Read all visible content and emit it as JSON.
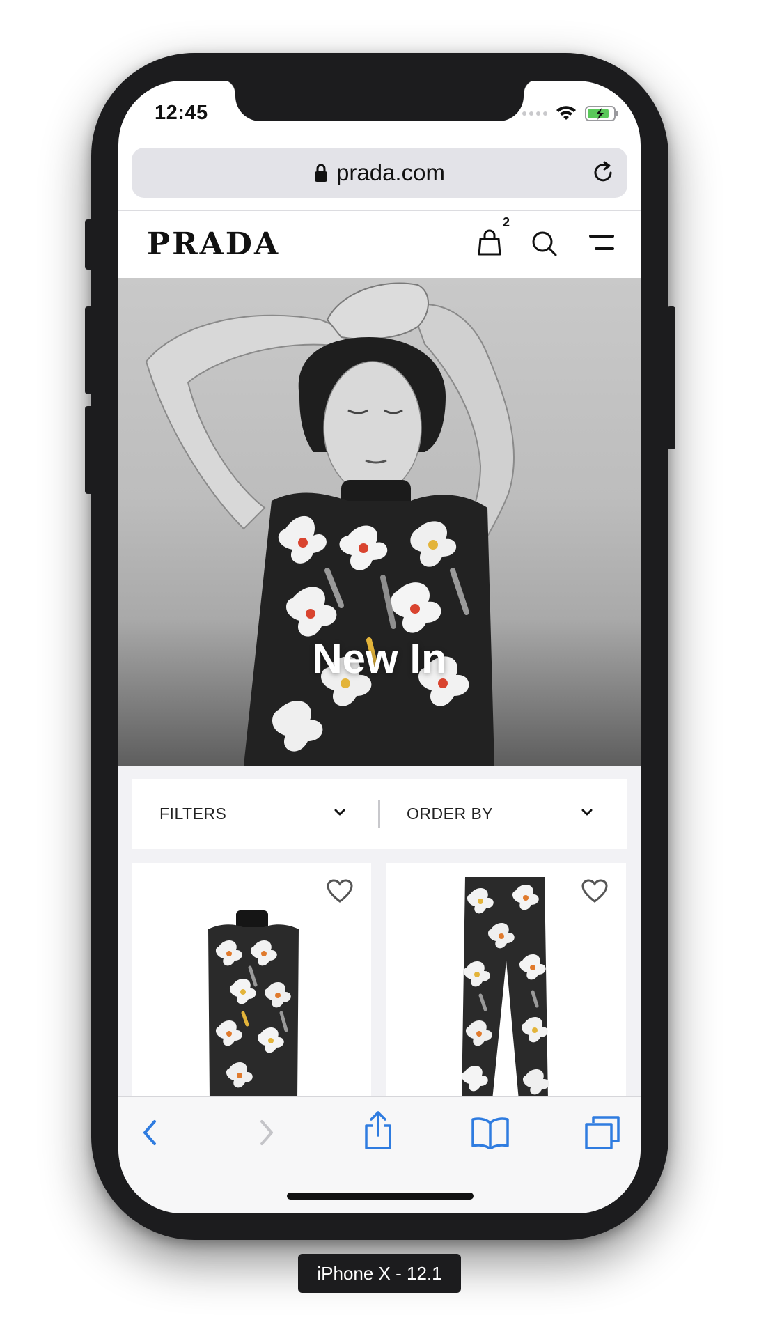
{
  "status_bar": {
    "time": "12:45"
  },
  "browser": {
    "url": "prada.com"
  },
  "site_header": {
    "logo": "PRADA",
    "bag_count": "2"
  },
  "hero": {
    "title": "New In"
  },
  "filters": {
    "filters_label": "FILTERS",
    "order_by_label": "ORDER BY"
  },
  "products": [
    {
      "type": "sleeveless-top-image"
    },
    {
      "type": "trousers-image"
    }
  ],
  "toolbar": {
    "icons": [
      "back-icon",
      "forward-icon",
      "share-icon",
      "bookmarks-icon",
      "tabs-icon"
    ]
  },
  "device_label": "iPhone X - 12.1",
  "colors": {
    "accent_blue": "#2f7ce0",
    "frame": "#1c1c1e",
    "page_bg": "#f2f2f5"
  }
}
